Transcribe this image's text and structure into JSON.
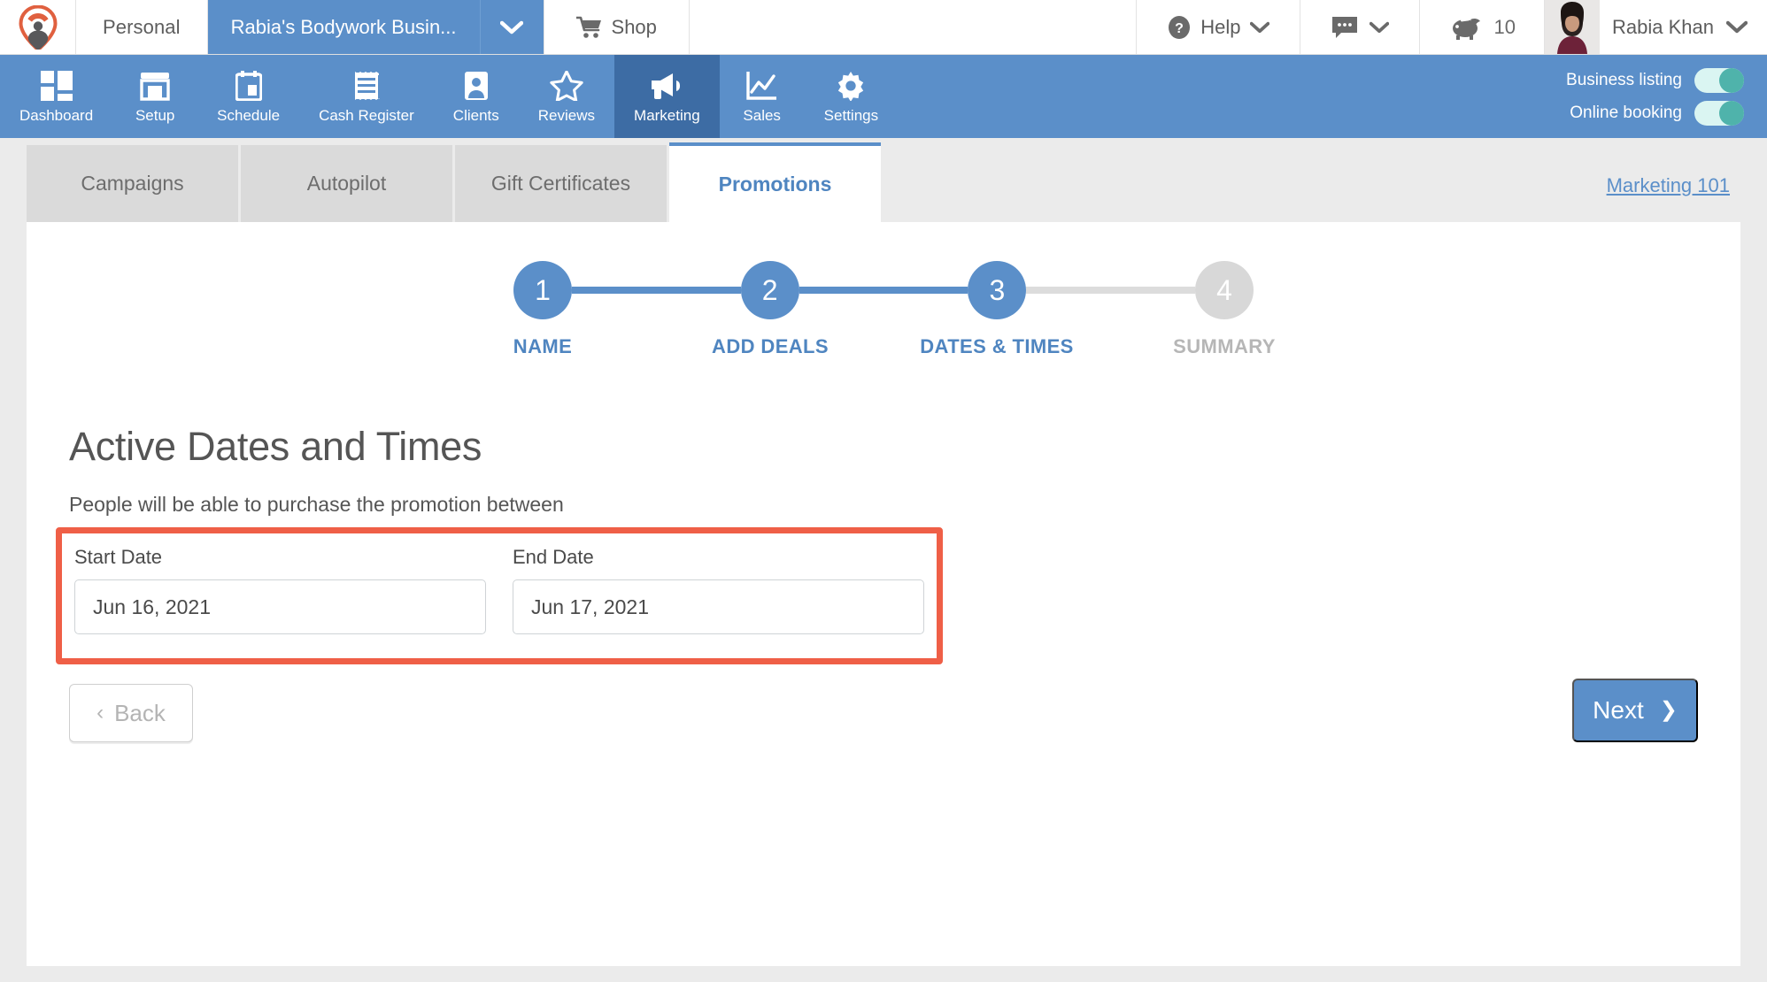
{
  "topbar": {
    "logo_icon": "map-pin-person-logo",
    "personal_label": "Personal",
    "business_label": "Rabia's Bodywork Busin...",
    "business_caret_icon": "chevron-down-icon",
    "shop_label": "Shop",
    "shop_icon": "shopping-cart-icon",
    "help_label": "Help",
    "help_icon": "question-circle-icon",
    "help_caret_icon": "chevron-down-icon",
    "chat_icon": "chat-bubble-icon",
    "chat_caret_icon": "chevron-down-icon",
    "piggy_icon": "piggy-bank-icon",
    "piggy_count": "10",
    "user_name": "Rabia Khan",
    "user_caret_icon": "chevron-down-icon",
    "avatar_alt": "user-avatar"
  },
  "nav": {
    "items": [
      {
        "label": "Dashboard",
        "icon": "dashboard-grid-icon",
        "active": false
      },
      {
        "label": "Setup",
        "icon": "storefront-icon",
        "active": false
      },
      {
        "label": "Schedule",
        "icon": "calendar-icon",
        "active": false
      },
      {
        "label": "Cash Register",
        "icon": "receipt-icon",
        "active": false
      },
      {
        "label": "Clients",
        "icon": "person-card-icon",
        "active": false
      },
      {
        "label": "Reviews",
        "icon": "star-icon",
        "active": false
      },
      {
        "label": "Marketing",
        "icon": "megaphone-icon",
        "active": true
      },
      {
        "label": "Sales",
        "icon": "line-chart-icon",
        "active": false
      },
      {
        "label": "Settings",
        "icon": "gear-icon",
        "active": false
      }
    ],
    "toggles": [
      {
        "label": "Business listing",
        "state": "on"
      },
      {
        "label": "Online booking",
        "state": "on"
      }
    ]
  },
  "tabs": {
    "items": [
      {
        "label": "Campaigns",
        "active": false
      },
      {
        "label": "Autopilot",
        "active": false
      },
      {
        "label": "Gift Certificates",
        "active": false
      },
      {
        "label": "Promotions",
        "active": true
      }
    ],
    "help_link": "Marketing 101"
  },
  "stepper": {
    "steps": [
      {
        "number": "1",
        "label": "NAME",
        "active": true
      },
      {
        "number": "2",
        "label": "ADD DEALS",
        "active": true
      },
      {
        "number": "3",
        "label": "DATES & TIMES",
        "active": true
      },
      {
        "number": "4",
        "label": "SUMMARY",
        "active": false
      }
    ]
  },
  "main": {
    "title": "Active Dates and Times",
    "subtitle": "People will be able to purchase the promotion between",
    "start_date": {
      "label": "Start Date",
      "value": "Jun 16, 2021"
    },
    "end_date": {
      "label": "End Date",
      "value": "Jun 17, 2021"
    }
  },
  "footer": {
    "back_label": "Back",
    "back_chevron": "‹",
    "next_label": "Next",
    "next_chevron": "❯"
  },
  "colors": {
    "brand_blue": "#5b8fc9",
    "brand_blue_dark": "#3d6ca4",
    "highlight_red": "#ef5f47",
    "toggle_green": "#4fb3ab",
    "logo_orange": "#e0603f",
    "page_gray": "#ebebeb"
  }
}
